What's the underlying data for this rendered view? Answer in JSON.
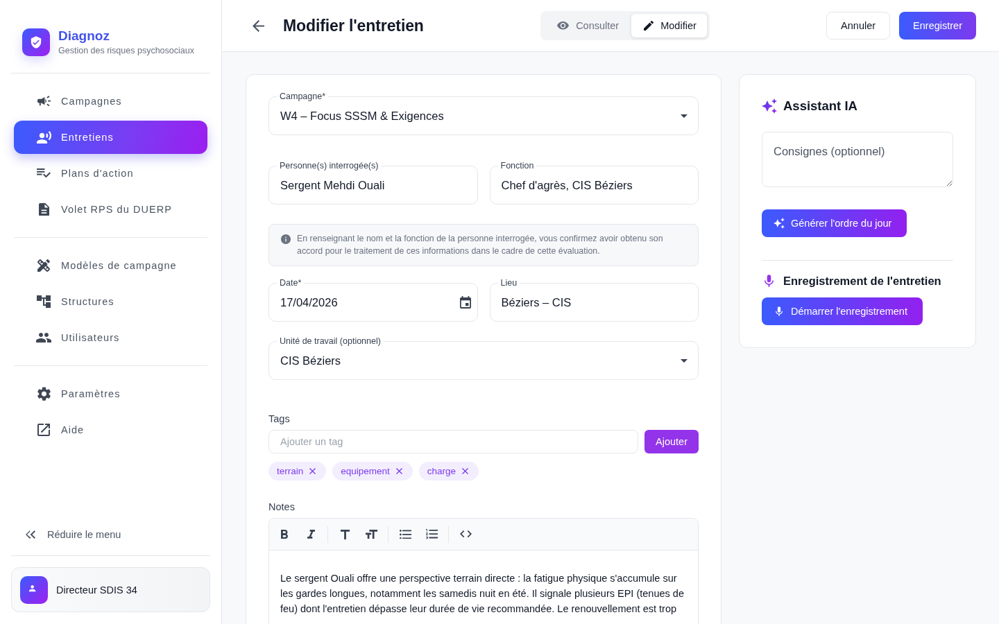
{
  "sidebar": {
    "brand": {
      "name": "Diagnoz",
      "tagline": "Gestion des risques psychosociaux"
    },
    "nav_groups": [
      {
        "items": [
          {
            "label": "Campagnes",
            "selected": false
          },
          {
            "label": "Entretiens",
            "selected": true
          },
          {
            "label": "Plans d'action",
            "selected": false
          },
          {
            "label": "Volet RPS du DUERP",
            "selected": false
          }
        ]
      },
      {
        "items": [
          {
            "label": "Modèles de campagne",
            "selected": false
          },
          {
            "label": "Structures",
            "selected": false
          },
          {
            "label": "Utilisateurs",
            "selected": false
          }
        ]
      },
      {
        "items": [
          {
            "label": "Paramètres",
            "selected": false
          },
          {
            "label": "Aide",
            "selected": false
          }
        ]
      }
    ],
    "collapse": "Réduire le menu",
    "user": {
      "name": "Directeur SDIS 34"
    }
  },
  "header": {
    "title": "Modifier l'entretien",
    "mode_toggle": [
      {
        "label": "Consulter",
        "selected": false
      },
      {
        "label": "Modifier",
        "selected": true
      }
    ],
    "buttons": [
      {
        "label": "Annuler",
        "kind": "secondary"
      },
      {
        "label": "Enregistrer",
        "kind": "primary"
      }
    ]
  },
  "form": {
    "campaign": {
      "label": "Campagne*",
      "value": "W4 – Focus SSSM & Exigences"
    },
    "person": {
      "label": "Personne(s) interrogée(s)",
      "value": "Sergent Mehdi Ouali"
    },
    "function": {
      "label": "Fonction",
      "value": "Chef d'agrès, CIS Béziers"
    },
    "consent_notice": "En renseignant le nom et la fonction de la personne interrogée, vous confirmez avoir obtenu son accord pour le traitement de ces informations dans le cadre de cette évaluation.",
    "date": {
      "label": "Date*",
      "value": "17/04/2026"
    },
    "location": {
      "label": "Lieu",
      "value": "Béziers – CIS"
    },
    "work_unit": {
      "label": "Unité de travail (optionnel)",
      "value": "CIS Béziers"
    },
    "tags": {
      "label": "Tags",
      "placeholder": "Ajouter un tag",
      "add_button": "Ajouter",
      "items": [
        "terrain",
        "equipement",
        "charge"
      ]
    },
    "notes": {
      "label": "Notes",
      "text": "Le sergent Ouali offre une perspective terrain directe : la fatigue physique s'accumule sur les gardes longues, notamment les samedis nuit en été. Il signale plusieurs EPI (tenues de feu) dont l'entretien dépasse leur durée de vie recommandée. Le renouvellement est trop"
    }
  },
  "assistant": {
    "title": "Assistant IA",
    "instructions": {
      "placeholder": "Consignes (optionnel)"
    },
    "generate_button": "Générer l'ordre du jour"
  },
  "recording": {
    "title": "Enregistrement de l'entretien",
    "start_button": "Démarrer l'enregistrement"
  }
}
